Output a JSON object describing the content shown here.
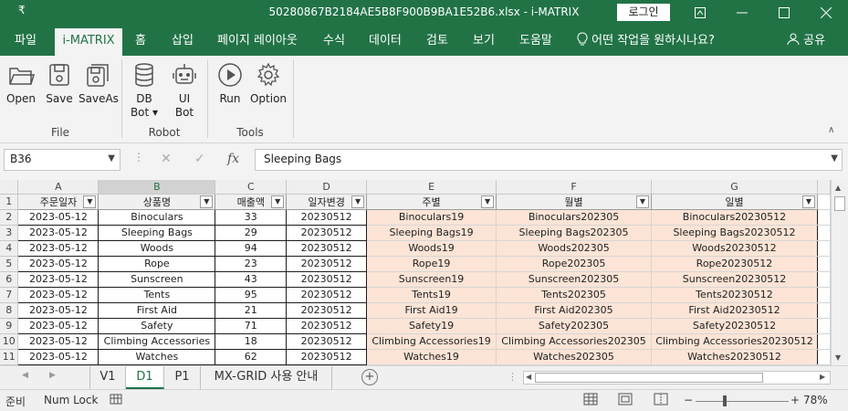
{
  "titlebar": {
    "quick_access": "₹",
    "title": "50280867B2184AE5B8F900B9BA1E52B6.xlsx  -  i-MATRIX",
    "login_label": "로그인",
    "ribbon_display_icon": "ribbon-display-icon",
    "minimize_icon": "minimize-icon",
    "maximize_icon": "maximize-icon",
    "close_icon": "close-icon"
  },
  "menu": {
    "items": [
      "파일",
      "i-MATRIX",
      "홈",
      "삽입",
      "페이지 레이아웃",
      "수식",
      "데이터",
      "검토",
      "보기",
      "도움말"
    ],
    "tell_me": "어떤 작업을 원하시나요?",
    "share": "공유"
  },
  "ribbon": {
    "file_group": {
      "label": "File",
      "buttons": [
        "Open",
        "Save",
        "SaveAs"
      ]
    },
    "robot_group": {
      "label": "Robot",
      "buttons": [
        "DB\nBot ▾",
        "UI\nBot"
      ],
      "db_line1": "DB",
      "db_line2": "Bot ▾",
      "ui_line1": "UI",
      "ui_line2": "Bot"
    },
    "tools_group": {
      "label": "Tools",
      "buttons": [
        "Run",
        "Option"
      ]
    },
    "collapse": "∧"
  },
  "formula_bar": {
    "name_box": "B36",
    "formula": "Sleeping Bags",
    "fx": "fx",
    "cancel": "✕",
    "enter": "✓"
  },
  "grid": {
    "columns": [
      "A",
      "B",
      "C",
      "D",
      "E",
      "F",
      "G"
    ],
    "selected_column": "B",
    "headers": [
      "주문일자",
      "상품명",
      "매출액",
      "일자변경",
      "주별",
      "월별",
      "일별"
    ],
    "rows": [
      {
        "n": "2",
        "c": [
          "2023-05-12",
          "Binoculars",
          "33",
          "20230512",
          "Binoculars19",
          "Binoculars202305",
          "Binoculars20230512"
        ]
      },
      {
        "n": "3",
        "c": [
          "2023-05-12",
          "Sleeping Bags",
          "29",
          "20230512",
          "Sleeping Bags19",
          "Sleeping Bags202305",
          "Sleeping Bags20230512"
        ]
      },
      {
        "n": "4",
        "c": [
          "2023-05-12",
          "Woods",
          "94",
          "20230512",
          "Woods19",
          "Woods202305",
          "Woods20230512"
        ]
      },
      {
        "n": "5",
        "c": [
          "2023-05-12",
          "Rope",
          "23",
          "20230512",
          "Rope19",
          "Rope202305",
          "Rope20230512"
        ]
      },
      {
        "n": "6",
        "c": [
          "2023-05-12",
          "Sunscreen",
          "43",
          "20230512",
          "Sunscreen19",
          "Sunscreen202305",
          "Sunscreen20230512"
        ]
      },
      {
        "n": "7",
        "c": [
          "2023-05-12",
          "Tents",
          "95",
          "20230512",
          "Tents19",
          "Tents202305",
          "Tents20230512"
        ]
      },
      {
        "n": "8",
        "c": [
          "2023-05-12",
          "First Aid",
          "21",
          "20230512",
          "First Aid19",
          "First Aid202305",
          "First Aid20230512"
        ]
      },
      {
        "n": "9",
        "c": [
          "2023-05-12",
          "Safety",
          "71",
          "20230512",
          "Safety19",
          "Safety202305",
          "Safety20230512"
        ]
      },
      {
        "n": "10",
        "c": [
          "2023-05-12",
          "Climbing Accessories",
          "18",
          "20230512",
          "Climbing Accessories19",
          "Climbing Accessories202305",
          "Climbing Accessories20230512"
        ]
      },
      {
        "n": "11",
        "c": [
          "2023-05-12",
          "Watches",
          "62",
          "20230512",
          "Watches19",
          "Watches202305",
          "Watches20230512"
        ]
      }
    ]
  },
  "sheets": {
    "tabs": [
      "V1",
      "D1",
      "P1",
      "MX-GRID 사용 안내"
    ],
    "active": "D1",
    "add": "+"
  },
  "status": {
    "ready": "준비",
    "num_lock": "Num Lock",
    "zoom_out": "−",
    "zoom_in": "+",
    "zoom": "78%"
  },
  "colors": {
    "accent": "#217346",
    "highlight_fill": "#fce4d6",
    "ribbon_bg": "#f3f3f3"
  }
}
